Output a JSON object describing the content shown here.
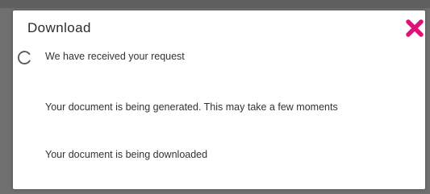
{
  "dialog": {
    "title": "Download",
    "close_icon": "close-x-icon",
    "accent_color": "#e0107a",
    "steps": [
      {
        "label": "We have received your request",
        "status": "in-progress",
        "icon": "loading-spinner-icon"
      },
      {
        "label": "Your document is being generated. This may take a few moments",
        "status": "pending"
      },
      {
        "label": "Your document is being downloaded",
        "status": "pending"
      }
    ]
  }
}
